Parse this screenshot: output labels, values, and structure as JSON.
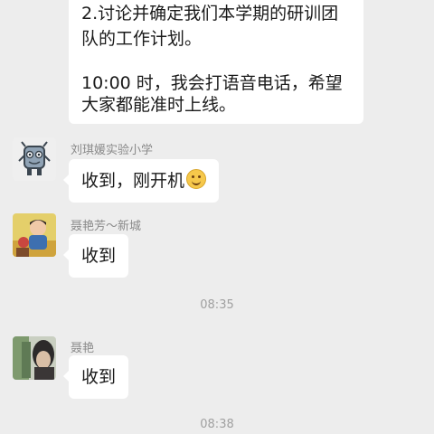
{
  "top_message": {
    "lines": [
      "2.讨论并确定我们本学期的研训团",
      "队的工作计划。",
      "",
      "10:00 时，我会打语音电话，希望",
      "大家都能准时上线。"
    ]
  },
  "messages": [
    {
      "sender": "刘琪媛实验小学",
      "text": "收到，刚开机",
      "emoji": "smile-emoji-icon",
      "avatar": "cartoon-robot-avatar"
    },
    {
      "sender": "聂艳芳～新城",
      "text": "收到",
      "avatar": "child-photo-avatar"
    },
    {
      "sender": "聂艳",
      "text": "收到",
      "avatar": "blurred-photo-avatar"
    }
  ],
  "timestamps": [
    "08:35",
    "08:38"
  ],
  "colors": {
    "background": "#ededed",
    "bubble": "#ffffff",
    "sender_text": "#8a8a8a",
    "timestamp_text": "#a0a0a0"
  }
}
